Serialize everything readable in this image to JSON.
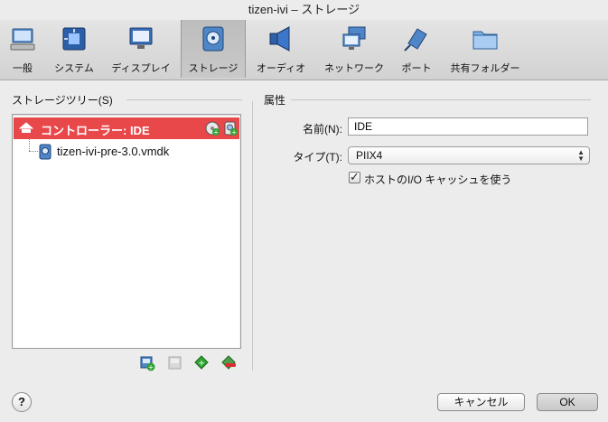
{
  "window": {
    "title": "tizen-ivi – ストレージ"
  },
  "toolbar": {
    "items": [
      {
        "label": "一般",
        "icon": "general-icon"
      },
      {
        "label": "システム",
        "icon": "system-icon"
      },
      {
        "label": "ディスプレイ",
        "icon": "display-icon"
      },
      {
        "label": "ストレージ",
        "icon": "storage-icon",
        "selected": true
      },
      {
        "label": "オーディオ",
        "icon": "audio-icon"
      },
      {
        "label": "ネットワーク",
        "icon": "network-icon"
      },
      {
        "label": "ポート",
        "icon": "port-icon"
      },
      {
        "label": "共有フォルダー",
        "icon": "shared-folder-icon"
      }
    ]
  },
  "left_panel": {
    "title": "ストレージツリー(S)",
    "controller_label": "コントローラー: IDE",
    "disk_label": "tizen-ivi-pre-3.0.vmdk"
  },
  "right_panel": {
    "title": "属性",
    "name_label": "名前(N):",
    "name_value": "IDE",
    "type_label": "タイプ(T):",
    "type_value": "PIIX4",
    "cache_label": "ホストのI/O キャッシュを使う",
    "cache_checked": true
  },
  "footer": {
    "help": "?",
    "cancel": "キャンセル",
    "ok": "OK"
  },
  "colors": {
    "selection": "#e9484a"
  }
}
